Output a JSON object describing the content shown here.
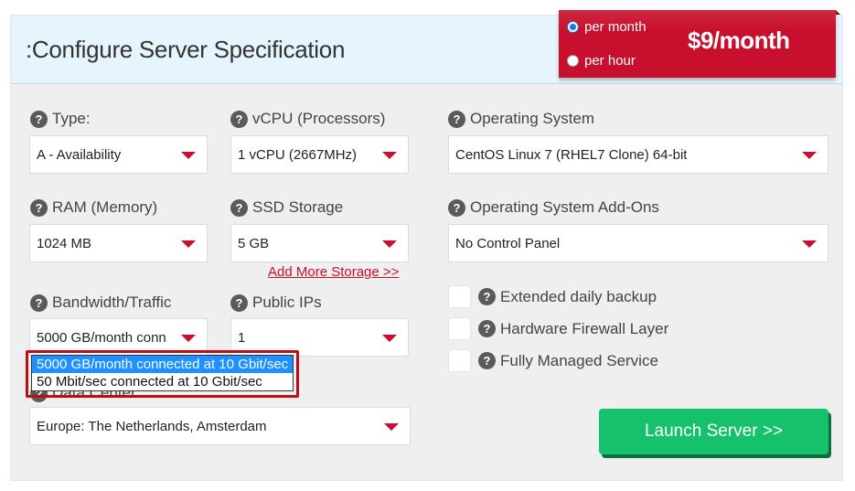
{
  "header": {
    "title": ":Configure Server Specification"
  },
  "pricing": {
    "options": [
      {
        "label": "per month",
        "checked": true
      },
      {
        "label": "per hour",
        "checked": false
      }
    ],
    "price": "$9/month"
  },
  "fields": {
    "type": {
      "label": "Type:",
      "value": "A - Availability"
    },
    "vcpu": {
      "label": "vCPU (Processors)",
      "value": "1 vCPU (2667MHz)"
    },
    "os": {
      "label": "Operating System",
      "value": "CentOS Linux 7 (RHEL7 Clone) 64-bit"
    },
    "ram": {
      "label": "RAM (Memory)",
      "value": "1024 MB"
    },
    "ssd": {
      "label": "SSD Storage",
      "value": "5 GB",
      "link": "Add More Storage >>"
    },
    "os_addons": {
      "label": "Operating System Add-Ons",
      "value": "No Control Panel"
    },
    "bandwidth": {
      "label": "Bandwidth/Traffic",
      "value": "5000 GB/month conn",
      "options": [
        {
          "label": "5000 GB/month connected at 10 Gbit/sec",
          "selected": true
        },
        {
          "label": "50 Mbit/sec connected at 10 Gbit/sec",
          "selected": false
        }
      ]
    },
    "public_ips": {
      "label": "Public IPs",
      "value": "1"
    },
    "data_center": {
      "label": "Data Center",
      "value": "Europe: The Netherlands, Amsterdam"
    }
  },
  "addons": [
    {
      "label": "Extended daily backup",
      "checked": false
    },
    {
      "label": "Hardware Firewall Layer",
      "checked": false
    },
    {
      "label": "Fully Managed Service",
      "checked": false
    }
  ],
  "actions": {
    "launch": "Launch Server >>"
  },
  "icons": {
    "help": "?"
  },
  "colors": {
    "accent_red": "#c8102e",
    "launch_green": "#15c26b",
    "highlight_blue": "#1e90ff"
  }
}
